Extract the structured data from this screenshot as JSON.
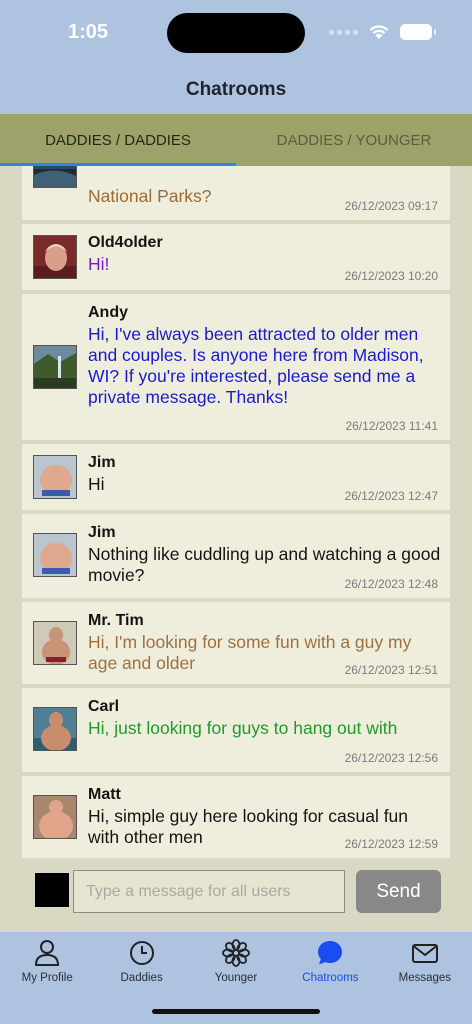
{
  "status_bar": {
    "time": "1:05"
  },
  "header": {
    "title": "Chatrooms"
  },
  "tabs": [
    {
      "label": "DADDIES / DADDIES",
      "active": true
    },
    {
      "label": "DADDIES / YOUNGER",
      "active": false
    }
  ],
  "messages": [
    {
      "sender": "",
      "text": "National Parks?",
      "timestamp": "26/12/2023 09:17",
      "text_color": "#9b6a35"
    },
    {
      "sender": "Old4older",
      "text": "Hi!",
      "timestamp": "26/12/2023 10:20",
      "text_color": "#7a1fb5"
    },
    {
      "sender": "Andy",
      "text": "Hi, I've always been attracted to older men and couples. Is anyone here from Madison, WI? If you're interested, please send me a private message. Thanks!",
      "timestamp": "26/12/2023 11:41",
      "text_color": "#1a1acc"
    },
    {
      "sender": "Jim",
      "text": "Hi",
      "timestamp": "26/12/2023 12:47",
      "text_color": "#141414"
    },
    {
      "sender": "Jim",
      "text": "Nothing like cuddling up and watching a good movie?",
      "timestamp": "26/12/2023 12:48",
      "text_color": "#141414"
    },
    {
      "sender": "Mr. Tim",
      "text": "Hi, I'm looking for some fun with a guy my age and older",
      "timestamp": "26/12/2023 12:51",
      "text_color": "#a0703e"
    },
    {
      "sender": "Carl",
      "text": "Hi, just looking for guys to hang out with",
      "timestamp": "26/12/2023 12:56",
      "text_color": "#1f9a2b"
    },
    {
      "sender": "Matt",
      "text": "Hi, simple guy here looking for casual fun with other men",
      "timestamp": "26/12/2023 12:59",
      "text_color": "#141414"
    }
  ],
  "composer": {
    "placeholder": "Type a message for all users",
    "send_label": "Send",
    "color_swatch": "#000000"
  },
  "tab_bar": [
    {
      "label": "My Profile",
      "icon": "person-icon",
      "active": false
    },
    {
      "label": "Daddies",
      "icon": "clock-icon",
      "active": false
    },
    {
      "label": "Younger",
      "icon": "flower-icon",
      "active": false
    },
    {
      "label": "Chatrooms",
      "icon": "chat-bubble-icon",
      "active": true
    },
    {
      "label": "Messages",
      "icon": "envelope-icon",
      "active": false
    }
  ],
  "colors": {
    "bar_blue": "#aec3df",
    "tab_olive": "#9fa16a",
    "card": "#efeedc",
    "accent_blue": "#2d86e6",
    "active_tab_label": "#1a4df0"
  }
}
